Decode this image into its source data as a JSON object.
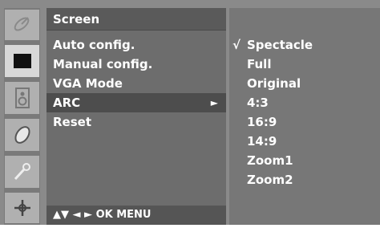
{
  "menu": {
    "title": "Screen",
    "items": [
      {
        "label": "Auto config.",
        "selected": false,
        "has_submenu": false
      },
      {
        "label": "Manual config.",
        "selected": false,
        "has_submenu": false
      },
      {
        "label": "VGA Mode",
        "selected": false,
        "has_submenu": false
      },
      {
        "label": "ARC",
        "selected": true,
        "has_submenu": true
      },
      {
        "label": "Reset",
        "selected": false,
        "has_submenu": false
      }
    ],
    "arrow_glyph": "►",
    "hint": "▲▼  ◄ ►  OK  MENU"
  },
  "submenu": {
    "check_glyph": "√",
    "options": [
      {
        "label": "Spectacle",
        "checked": true
      },
      {
        "label": "Full",
        "checked": false
      },
      {
        "label": "Original",
        "checked": false
      },
      {
        "label": "4:3",
        "checked": false
      },
      {
        "label": "16:9",
        "checked": false
      },
      {
        "label": "14:9",
        "checked": false
      },
      {
        "label": "Zoom1",
        "checked": false
      },
      {
        "label": "Zoom2",
        "checked": false
      }
    ]
  },
  "side_icons": [
    "satellite-dish-icon",
    "screen-icon",
    "speaker-icon",
    "clock-icon",
    "key-icon",
    "option-icon"
  ],
  "colors": {
    "osd_background": "#8a8a8a",
    "menu_panel": "#6d6d6d",
    "selected_row": "#4d4d4d",
    "submenu_panel": "#777777",
    "text": "#ffffff"
  }
}
